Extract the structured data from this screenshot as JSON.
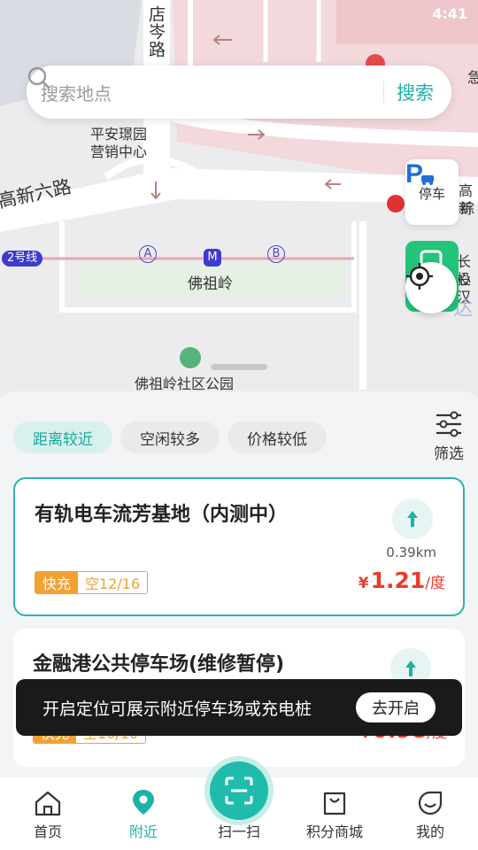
{
  "status_bar": {
    "time": "4:41"
  },
  "map": {
    "labels": {
      "dian_cen_road": "店岑路",
      "ping_an_1": "平安璟园",
      "ping_an_2": "营销中心",
      "gaoxin_road": "高新六路",
      "metro_line": "2号线",
      "station": "佛祖岭",
      "exit_a": "A",
      "exit_b": "B",
      "park": "佛祖岭社区公园",
      "right_1": "急",
      "right_2": "高新",
      "right_3": "综",
      "right_4": "长投",
      "right_5": "心汉",
      "right_6": "达"
    },
    "parking_label": "停车"
  },
  "search": {
    "placeholder": "搜索地点",
    "button": "搜索"
  },
  "filters": {
    "chips": [
      "距离较近",
      "空闲较多",
      "价格较低"
    ],
    "filter_label": "筛选"
  },
  "cards": [
    {
      "title": "有轨电车流芳基地（内测中）",
      "distance": "0.39km",
      "type": "快充",
      "free": "空12/16",
      "currency": "¥",
      "price": "1.21",
      "unit": "/度"
    },
    {
      "title": "金融港公共停车场(维修暂停)",
      "distance": "",
      "type": "快充",
      "free": "空10/10",
      "currency": "¥",
      "price": "0.98",
      "unit": "/度"
    }
  ],
  "toast": {
    "message": "开启定位可展示附近停车场或充电桩",
    "button": "去开启"
  },
  "bottom_nav": {
    "items": [
      "首页",
      "附近",
      "扫一扫",
      "积分商城",
      "我的"
    ],
    "active_index": 1
  },
  "colors": {
    "accent": "#1cb2a8",
    "price": "#ea3b2e",
    "tag": "#f3a033"
  }
}
